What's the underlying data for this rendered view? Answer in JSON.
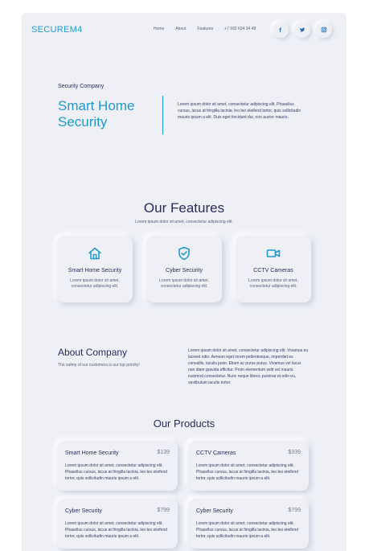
{
  "brand": {
    "logo": "SECUREM4",
    "accent": "#1f9ac9",
    "background": "#eef0f6"
  },
  "nav": {
    "home": "Home",
    "about": "About",
    "features": "Features",
    "phone": "+7 932 634 34 48"
  },
  "social": [
    {
      "icon": "facebook-icon"
    },
    {
      "icon": "twitter-icon"
    },
    {
      "icon": "instagram-icon"
    }
  ],
  "hero": {
    "eyebrow": "Security Company",
    "title_line1": "Smart Home",
    "title_line2": "Security",
    "text": "Lorem ipsum dolor sit amet, consectetur adipiscing elit. Phasellus cursus, lacus at fringilla lacinia, leo leo eleifend tortor, quis sollicitudin mauris ipsum a elit. Duis eget tincidunt dui, non auctor mauris."
  },
  "features": {
    "title": "Our Features",
    "subtitle": "Lorem ipsum dolor sit amet, consectetur adipiscing elit.",
    "items": [
      {
        "icon": "home-icon",
        "title": "Smart Home Security",
        "text": "Lorem ipsum dolor sit amet, consectetur adipiscing elit."
      },
      {
        "icon": "shield-check-icon",
        "title": "Cyber Security",
        "text": "Lorem ipsum dolor sit amet, consectetur adipiscing elit."
      },
      {
        "icon": "video-camera-icon",
        "title": "CCTV Cameras",
        "text": "Lorem ipsum dolor sit amet, consectetur adipiscing elit."
      }
    ]
  },
  "about": {
    "title": "About Company",
    "subtitle": "The safety of our customers is our top priority!",
    "text": "Lorem ipsum dolor sit amet, consectetur adipiscing elit. Vivamus eu laoreet odio. Aenean eget lorem pellentesque, imperdiet ex convallis, iaculis justo. Etiam ac purus purus. Vivamus vel lacus non diam gravida efficitur. Proin elementum velit vel mauris euismod consectetur. Nunc neque libero, pulvinar et odio eu, vestibulum iaculis tortor."
  },
  "products": {
    "title": "Our Products",
    "items": [
      {
        "name": "Smart Home Security",
        "price": "$139",
        "text": "Lorem ipsum dolor sit amet, consectetur adipiscing elit. Phasellus cursus, lacus at fringilla lacinia, leo leo eleifend tortor, quis sollicitudin mauris ipsum a elit."
      },
      {
        "name": "CCTV Cameras",
        "price": "$339",
        "text": "Lorem ipsum dolor sit amet, consectetur adipiscing elit. Phasellus cursus, lacus at fringilla lacinia, leo leo eleifend tortor, quis sollicitudin mauris ipsum a elit."
      },
      {
        "name": "Cyber Security",
        "price": "$799",
        "text": "Lorem ipsum dolor sit amet, consectetur adipiscing elit. Phasellus cursus, lacus at fringilla lacinia, leo leo eleifend tortor, quis sollicitudin mauris ipsum a elit."
      },
      {
        "name": "Cyber Security",
        "price": "$799",
        "text": "Lorem ipsum dolor sit amet, consectetur adipiscing elit. Phasellus cursus, lacus at fringilla lacinia, leo leo eleifend tortor, quis sollicitudin mauris ipsum a elit."
      }
    ]
  }
}
